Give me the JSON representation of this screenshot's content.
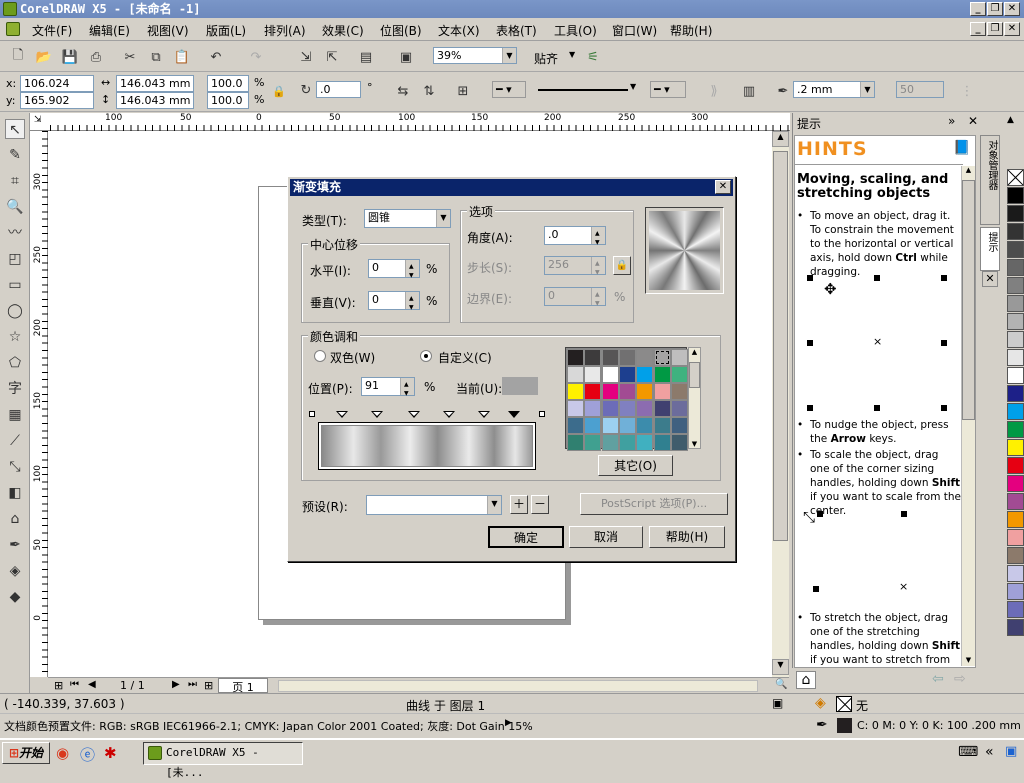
{
  "app": {
    "title": "CorelDRAW X5 - [未命名 -1]"
  },
  "menu": [
    "文件(F)",
    "编辑(E)",
    "视图(V)",
    "版面(L)",
    "排列(A)",
    "效果(C)",
    "位图(B)",
    "文本(X)",
    "表格(T)",
    "工具(O)",
    "窗口(W)",
    "帮助(H)"
  ],
  "standard_toolbar": {
    "zoom": "39%",
    "snap_label": "贴齐"
  },
  "property_bar": {
    "x": "106.024 mm",
    "y": "165.902 mm",
    "w": "146.043 mm",
    "h": "146.043 mm",
    "scale_x": "100.0",
    "scale_y": "100.0",
    "percent": "%",
    "x_label": "x:",
    "y_label": "y:",
    "rotation": ".0",
    "degree": "°",
    "outline_width": ".2 mm",
    "miter": "50"
  },
  "rulers": {
    "h_ticks": [
      "100",
      "50",
      "0",
      "50",
      "100",
      "150",
      "200",
      "250",
      "300"
    ],
    "v_ticks": [
      "300",
      "250",
      "200",
      "150",
      "100",
      "50",
      "0"
    ]
  },
  "dialog": {
    "title": "渐变填充",
    "type_label": "类型(T):",
    "type_value": "圆锥",
    "center_offset_label": "中心位移",
    "horizontal_label": "水平(I):",
    "horizontal_value": "0",
    "vertical_label": "垂直(V):",
    "vertical_value": "0",
    "percent": "%",
    "options_label": "选项",
    "angle_label": "角度(A):",
    "angle_value": ".0",
    "steps_label": "步长(S):",
    "steps_value": "256",
    "edge_label": "边界(E):",
    "edge_value": "0",
    "color_blend_label": "颜色调和",
    "two_color_label": "双色(W)",
    "custom_label": "自定义(C)",
    "position_label": "位置(P):",
    "position_value": "91",
    "current_label": "当前(U):",
    "others_button": "其它(O)",
    "presets_label": "预设(R):",
    "postscript_button": "PostScript 选项(P)...",
    "ok_button": "确定",
    "cancel_button": "取消",
    "help_button": "帮助(H)",
    "swatch_colors": [
      "#231f20",
      "#3d3b3c",
      "#575556",
      "#717071",
      "#8b8a8a",
      "#a5a4a4",
      "#bfbebe",
      "#d8d8d8",
      "#e8e8e8",
      "#ffffff",
      "#1d3f8f",
      "#00a0e9",
      "#009944",
      "#3fb27f",
      "#fff100",
      "#e60012",
      "#e4007f",
      "#a24b93",
      "#f39800",
      "#f0a0a0",
      "#8c7a6b",
      "#c8c8e8",
      "#9fa0d8",
      "#6c6cb8",
      "#8080c0",
      "#8c6cb0",
      "#404070",
      "#6c6c9c",
      "#3c6c8c",
      "#4ca0d0",
      "#9cd0f0",
      "#70b0d8",
      "#3c8cac",
      "#3c7c8c",
      "#406080",
      "#308070",
      "#40a090",
      "#60a0a0",
      "#40a0a0",
      "#40b0c0",
      "#308090",
      "#405c6c"
    ]
  },
  "hints": {
    "tab_label": "提示",
    "heading": "HINTS",
    "title": "Moving, scaling, and stretching objects",
    "b1_a": "To move an object, drag it. To constrain the movement to the horizontal or vertical axis, hold down ",
    "b1_key": "Ctrl",
    "b1_b": " while dragging.",
    "b2_a": "To nudge the object, press the ",
    "b2_key": "Arrow",
    "b2_b": " keys.",
    "b3_a": "To scale the object, drag one of the corner sizing handles, holding down ",
    "b3_key": "Shift",
    "b3_b": " if you want to scale from the center.",
    "b4": "To stretch the object, drag one of the stretching handles, holding down ",
    "b4_key": "Shift",
    "b4_b": " if you want to stretch from the",
    "vtab1": "对象管理器",
    "vtab2": "提示"
  },
  "palette_colors": [
    "#ffffff",
    "#000000",
    "#1a1a1a",
    "#333333",
    "#4d4d4d",
    "#666666",
    "#808080",
    "#999999",
    "#b3b3b3",
    "#cccccc",
    "#e6e6e6",
    "#ffffff",
    "#1d2088",
    "#00a0e9",
    "#009944",
    "#fff100",
    "#e60012",
    "#e4007f",
    "#a24b93",
    "#f39800",
    "#f0a0a0",
    "#8c7a6b",
    "#c8c8e8",
    "#9fa0d8",
    "#6c6cb8",
    "#404070"
  ],
  "page_nav": {
    "counter": "1 / 1",
    "tab": "页 1"
  },
  "status": {
    "coords": "( -140.339, 37.603 )",
    "object": "曲线 于 图层 1",
    "fill_none": "无",
    "profile": "文档颜色预置文件: RGB: sRGB IEC61966-2.1; CMYK: Japan Color 2001 Coated; 灰度: Dot Gain 15%",
    "outline_info": "C: 0 M: 0 Y: 0 K: 100  .200 mm"
  },
  "taskbar": {
    "start": "开始",
    "task": "CorelDRAW X5 - [未..."
  }
}
